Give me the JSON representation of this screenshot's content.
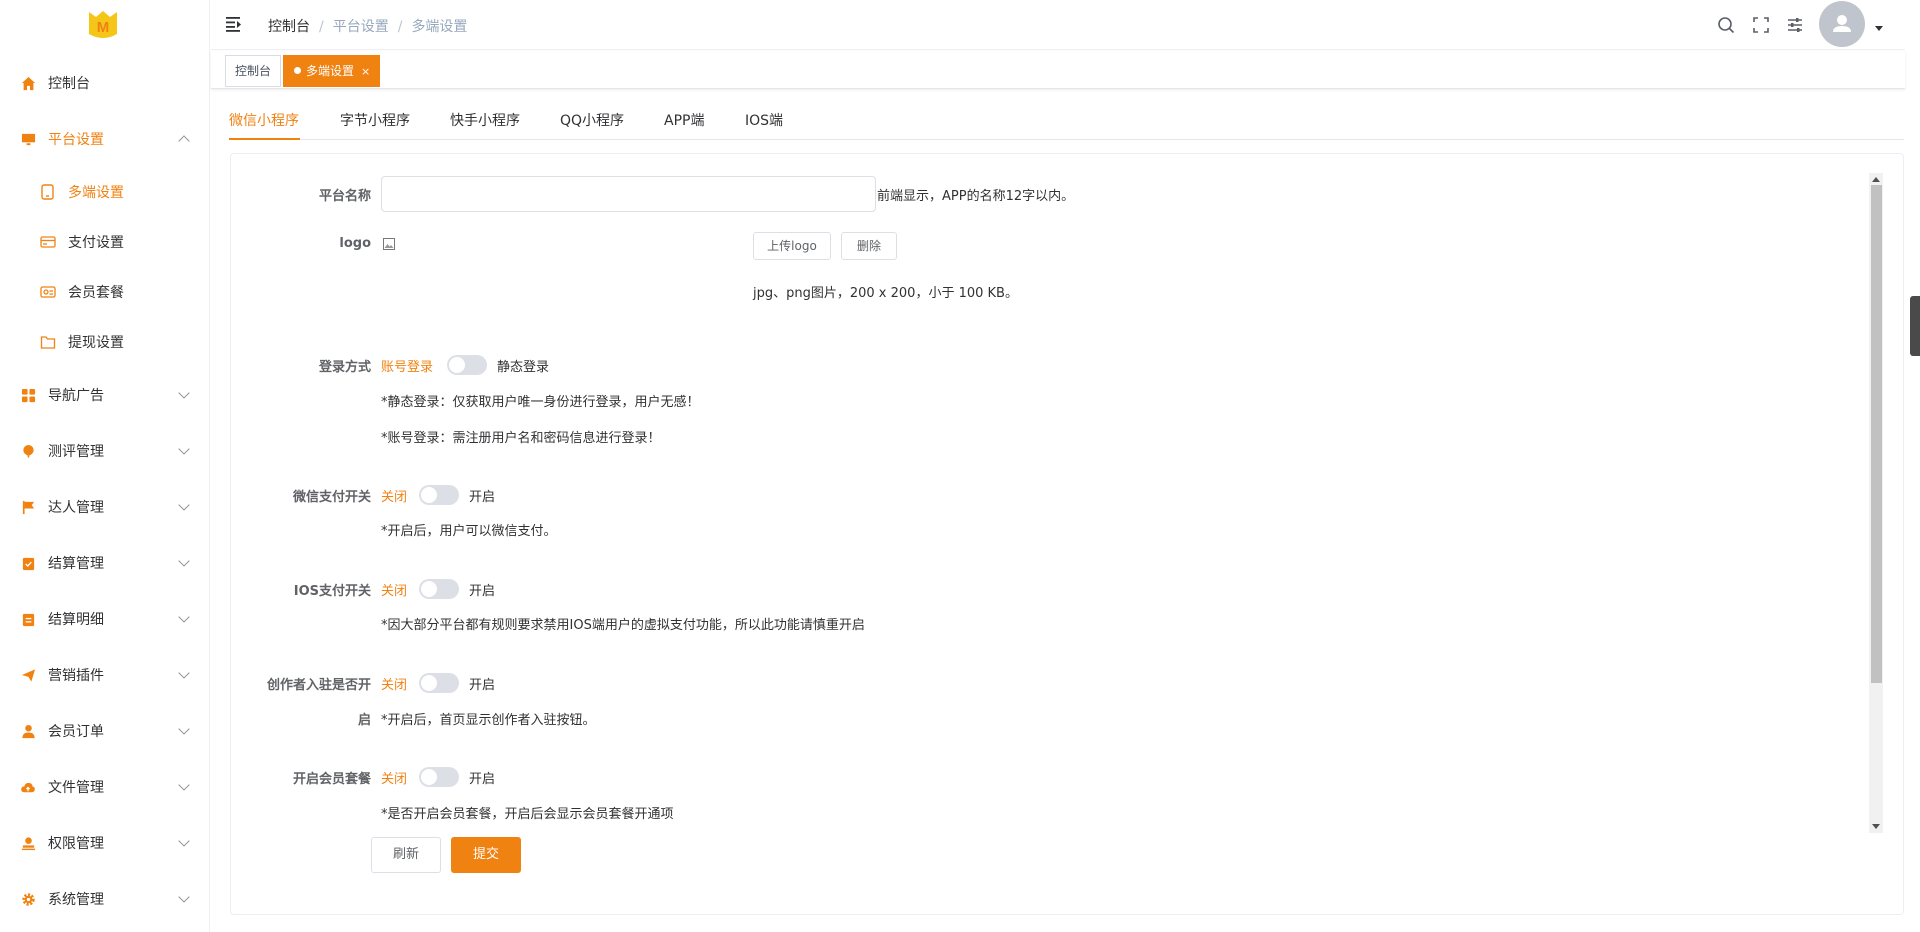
{
  "colors": {
    "accent": "#f08212",
    "text": "#303133",
    "muted": "#97a8be"
  },
  "sidebar": {
    "logo_letter": "M",
    "items": [
      {
        "label": "控制台",
        "icon": "home-icon"
      },
      {
        "label": "平台设置",
        "icon": "monitor-icon",
        "expanded": true
      },
      {
        "label": "导航广告",
        "icon": "grid-icon"
      },
      {
        "label": "测评管理",
        "icon": "balloon-icon"
      },
      {
        "label": "达人管理",
        "icon": "flag-icon"
      },
      {
        "label": "结算管理",
        "icon": "clipboard-check-icon"
      },
      {
        "label": "结算明细",
        "icon": "clipboard-list-icon"
      },
      {
        "label": "营销插件",
        "icon": "send-icon"
      },
      {
        "label": "会员订单",
        "icon": "user-icon"
      },
      {
        "label": "文件管理",
        "icon": "cloud-upload-icon"
      },
      {
        "label": "权限管理",
        "icon": "user-stamp-icon"
      },
      {
        "label": "系统管理",
        "icon": "gear-icon"
      }
    ],
    "subitems": [
      {
        "label": "多端设置",
        "icon": "tablet-icon"
      },
      {
        "label": "支付设置",
        "icon": "card-icon"
      },
      {
        "label": "会员套餐",
        "icon": "id-card-icon"
      },
      {
        "label": "提现设置",
        "icon": "folder-icon"
      }
    ]
  },
  "header": {
    "breadcrumb": [
      "控制台",
      "平台设置",
      "多端设置"
    ],
    "icons": [
      "search-icon",
      "fullscreen-icon",
      "sliders-icon"
    ]
  },
  "tags": [
    {
      "label": "控制台"
    },
    {
      "label": "多端设置",
      "close": "×"
    }
  ],
  "tabs": [
    "微信小程序",
    "字节小程序",
    "快手小程序",
    "QQ小程序",
    "APP端",
    "IOS端"
  ],
  "form": {
    "platform_name": {
      "label": "平台名称",
      "value": "",
      "hint": "前端显示，APP的名称12字以内。"
    },
    "logo": {
      "label": "logo",
      "upload_label": "上传logo",
      "delete_label": "删除",
      "hint": "jpg、png图片，200 x 200，小于 100 KB。"
    },
    "login": {
      "label": "登录方式",
      "left": "账号登录",
      "right": "静态登录",
      "note1": "*静态登录：仅获取用户唯一身份进行登录，用户无感！",
      "note2": "*账号登录：需注册用户名和密码信息进行登录！"
    },
    "wxpay": {
      "label": "微信支付开关",
      "left": "关闭",
      "right": "开启",
      "note": "*开启后，用户可以微信支付。"
    },
    "iospay": {
      "label": "IOS支付开关",
      "left": "关闭",
      "right": "开启",
      "note": "*因大部分平台都有规则要求禁用IOS端用户的虚拟支付功能，所以此功能请慎重开启"
    },
    "creator": {
      "label_line1": "创作者入驻是否开",
      "label_line2": "启",
      "left": "关闭",
      "right": "开启",
      "note": "*开启后，首页显示创作者入驻按钮。"
    },
    "member": {
      "label": "开启会员套餐",
      "left": "关闭",
      "right": "开启",
      "note": "*是否开启会员套餐，开启后会显示会员套餐开通项"
    }
  },
  "actions": {
    "refresh": "刷新",
    "submit": "提交"
  }
}
